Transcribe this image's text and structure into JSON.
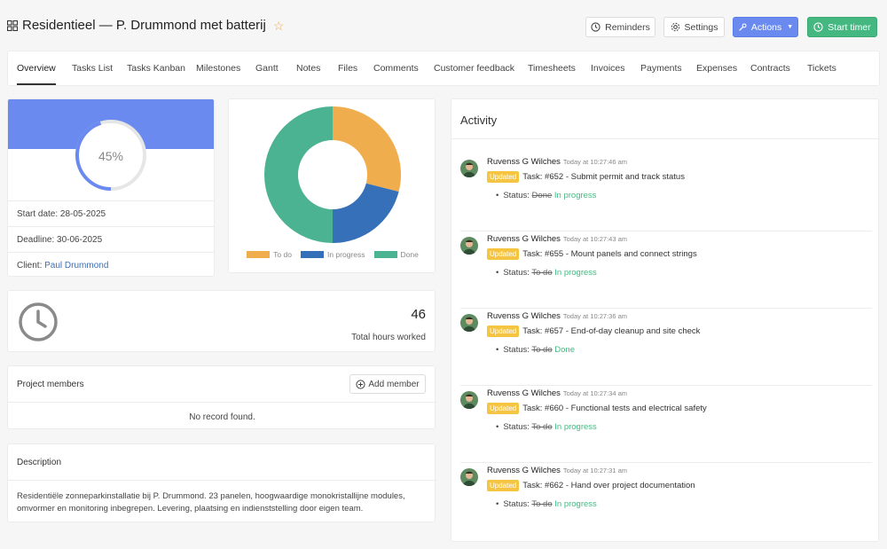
{
  "header": {
    "title": "Residentieel — P. Drummond met batterij",
    "buttons": {
      "reminders": "Reminders",
      "settings": "Settings",
      "actions": "Actions",
      "start_timer": "Start timer"
    }
  },
  "tabs": [
    "Overview",
    "Tasks List",
    "Tasks Kanban",
    "Milestones",
    "Gantt",
    "Notes",
    "Files",
    "Comments",
    "Customer feedback",
    "Timesheets",
    "Invoices",
    "Payments",
    "Expenses",
    "Contracts",
    "Tickets"
  ],
  "active_tab": "Overview",
  "project": {
    "progress_label": "45%",
    "progress_value": 0.45,
    "start_date": "Start date: 28-05-2025",
    "deadline": "Deadline: 30-06-2025",
    "client_label": "Client:",
    "client_name": "Paul Drummond"
  },
  "chart_data": {
    "type": "pie",
    "categories": [
      "To do",
      "In progress",
      "Done"
    ],
    "values": [
      29,
      21,
      50
    ],
    "colors": [
      "#f0ad4e",
      "#3570b8",
      "#4cb392"
    ],
    "legend_position": "bottom"
  },
  "hours": {
    "value": "46",
    "label": "Total hours worked"
  },
  "members": {
    "title": "Project members",
    "add_label": "Add member",
    "empty": "No record found."
  },
  "description": {
    "title": "Description",
    "text": "Residentiële zonneparkinstallatie bij P. Drummond. 23 panelen, hoogwaardige monokristallijne modules, omvormer en monitoring inbegrepen. Levering, plaatsing en indienststelling door eigen team."
  },
  "activity": {
    "title": "Activity",
    "items": [
      {
        "user": "Ruvenss G Wilches",
        "time": "Today at 10:27:46 am",
        "badge": "Updated",
        "task": "Task: #652 - Submit permit and track status",
        "status_label": "Status:",
        "old": "Done",
        "new": "In progress"
      },
      {
        "user": "Ruvenss G Wilches",
        "time": "Today at 10:27:43 am",
        "badge": "Updated",
        "task": "Task: #655 - Mount panels and connect strings",
        "status_label": "Status:",
        "old": "To do",
        "new": "In progress"
      },
      {
        "user": "Ruvenss G Wilches",
        "time": "Today at 10:27:36 am",
        "badge": "Updated",
        "task": "Task: #657 - End-of-day cleanup and site check",
        "status_label": "Status:",
        "old": "To do",
        "new": "Done"
      },
      {
        "user": "Ruvenss G Wilches",
        "time": "Today at 10:27:34 am",
        "badge": "Updated",
        "task": "Task: #660 - Functional tests and electrical safety",
        "status_label": "Status:",
        "old": "To do",
        "new": "In progress"
      },
      {
        "user": "Ruvenss G Wilches",
        "time": "Today at 10:27:31 am",
        "badge": "Updated",
        "task": "Task: #662 - Hand over project documentation",
        "status_label": "Status:",
        "old": "To do",
        "new": "In progress"
      }
    ]
  },
  "colors": {
    "primary": "#6b8af0",
    "success": "#45b882",
    "warning": "#f5c542"
  },
  "icons": [
    "grid-icon",
    "star-icon",
    "clock-icon",
    "gear-icon",
    "wrench-icon",
    "caret-down-icon",
    "plus-circle-icon",
    "avatar"
  ]
}
